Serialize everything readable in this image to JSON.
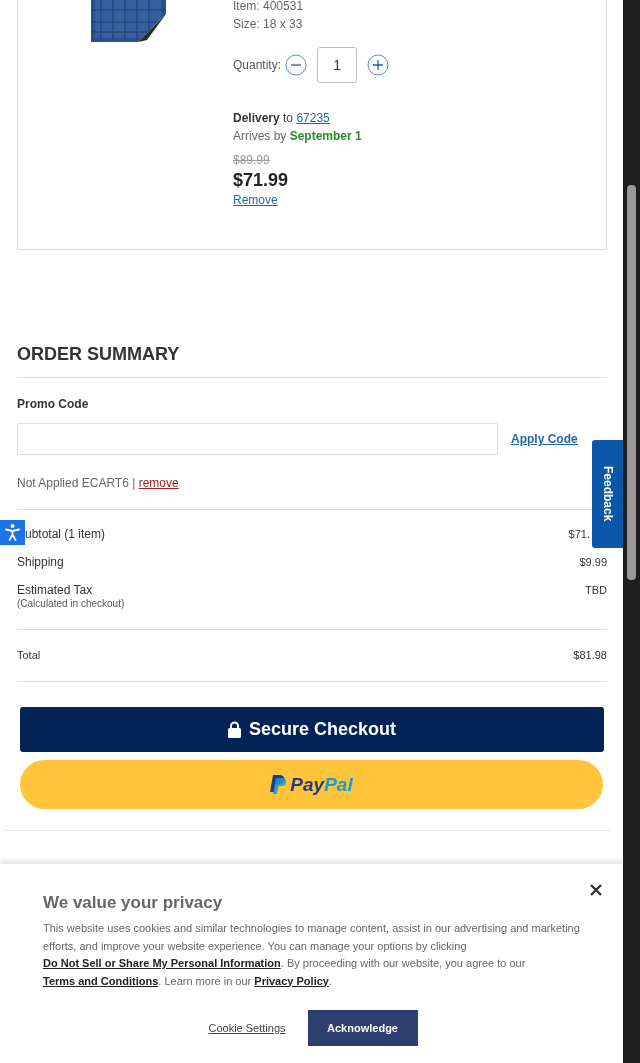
{
  "cart_item": {
    "item": "Item: 400531",
    "size": "Size: 18 x 33",
    "quantity_label": "Quantity:",
    "quantity": "1",
    "delivery_label": "Delivery",
    "delivery_to": "to",
    "zip": "67235",
    "arrives_label": "Arrives by",
    "arrives_date": "September 1",
    "old_price": "$89.99",
    "price": "$71.99",
    "remove": "Remove"
  },
  "order_summary": {
    "title": "ORDER SUMMARY",
    "promo": {
      "label": "Promo Code",
      "apply": "Apply Code",
      "status": "Not Applied ECART6",
      "separator": "|",
      "remove": "remove"
    },
    "lines": [
      {
        "label": "ubtotal (1 item)",
        "value": "$71."
      },
      {
        "label": "Shipping",
        "value": "$9.99"
      },
      {
        "label": "Estimated Tax",
        "note": "(Calculated in checkout)",
        "value": "TBD"
      }
    ],
    "total": {
      "label": "Total",
      "value": "$81.98"
    },
    "checkout": "Secure Checkout",
    "paypal": {
      "pay": "Pay",
      "pal": "Pal"
    }
  },
  "feedback": "Feedback",
  "privacy": {
    "title": "We value your privacy",
    "body": [
      {
        "kind": "text",
        "text": "This website uses cookies and similar technologies to manage content, assist in our advertising and marketing efforts, and improve your website experience. You can manage your options by clicking "
      },
      {
        "kind": "link",
        "text": "Do Not Sell or Share My Personal Information"
      },
      {
        "kind": "text",
        "text": ". By proceeding with our website, you agree to our "
      },
      {
        "kind": "link",
        "text": "Terms and Conditions"
      },
      {
        "kind": "text",
        "text": ". Learn more in our "
      },
      {
        "kind": "link",
        "text": "Privacy Policy"
      },
      {
        "kind": "text",
        "text": "."
      }
    ],
    "cookie_settings": "Cookie Settings",
    "acknowledge": "Acknowledge"
  }
}
